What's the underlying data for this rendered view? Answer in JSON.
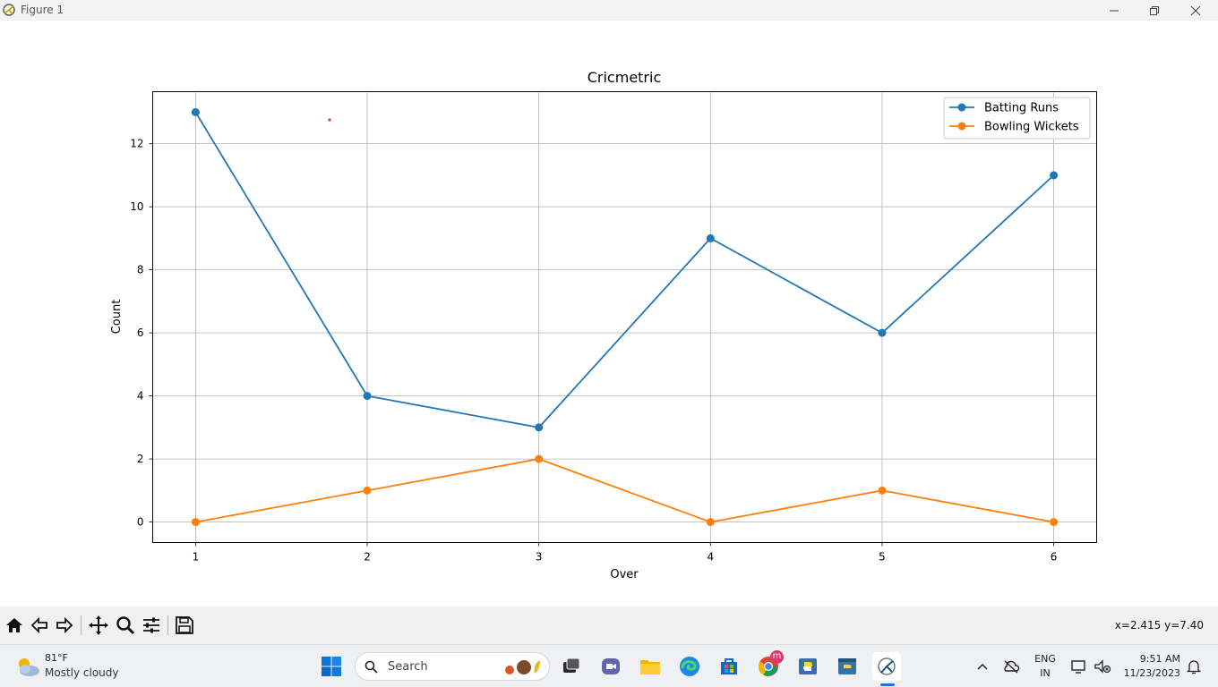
{
  "window": {
    "title": "Figure 1"
  },
  "chart_data": {
    "type": "line",
    "title": "Cricmetric",
    "xlabel": "Over",
    "ylabel": "Count",
    "x": [
      1,
      2,
      3,
      4,
      5,
      6
    ],
    "xticks": [
      "1",
      "2",
      "3",
      "4",
      "5",
      "6"
    ],
    "yticks": [
      "0",
      "2",
      "4",
      "6",
      "8",
      "10",
      "12"
    ],
    "xlim": [
      0.75,
      6.25
    ],
    "ylim": [
      -0.65,
      13.65
    ],
    "grid": true,
    "legend_position": "top-right",
    "series": [
      {
        "name": "Batting Runs",
        "values": [
          13,
          4,
          3,
          9,
          6,
          11
        ],
        "color": "#1f77b4"
      },
      {
        "name": "Bowling Wickets",
        "values": [
          0,
          1,
          2,
          0,
          1,
          0
        ],
        "color": "#ff7f0e"
      }
    ]
  },
  "toolbar": {
    "buttons": [
      "home-icon",
      "back-icon",
      "forward-icon",
      "pan-icon",
      "zoom-icon",
      "configure-subplots-icon",
      "save-icon"
    ],
    "coords": "x=2.415 y=7.40"
  },
  "taskbar": {
    "weather_temp": "81°F",
    "weather_desc": "Mostly cloudy",
    "search_placeholder": "Search",
    "lang_top": "ENG",
    "lang_bottom": "IN",
    "time": "9:51 AM",
    "date": "11/23/2023",
    "chrome_badge": "m"
  }
}
